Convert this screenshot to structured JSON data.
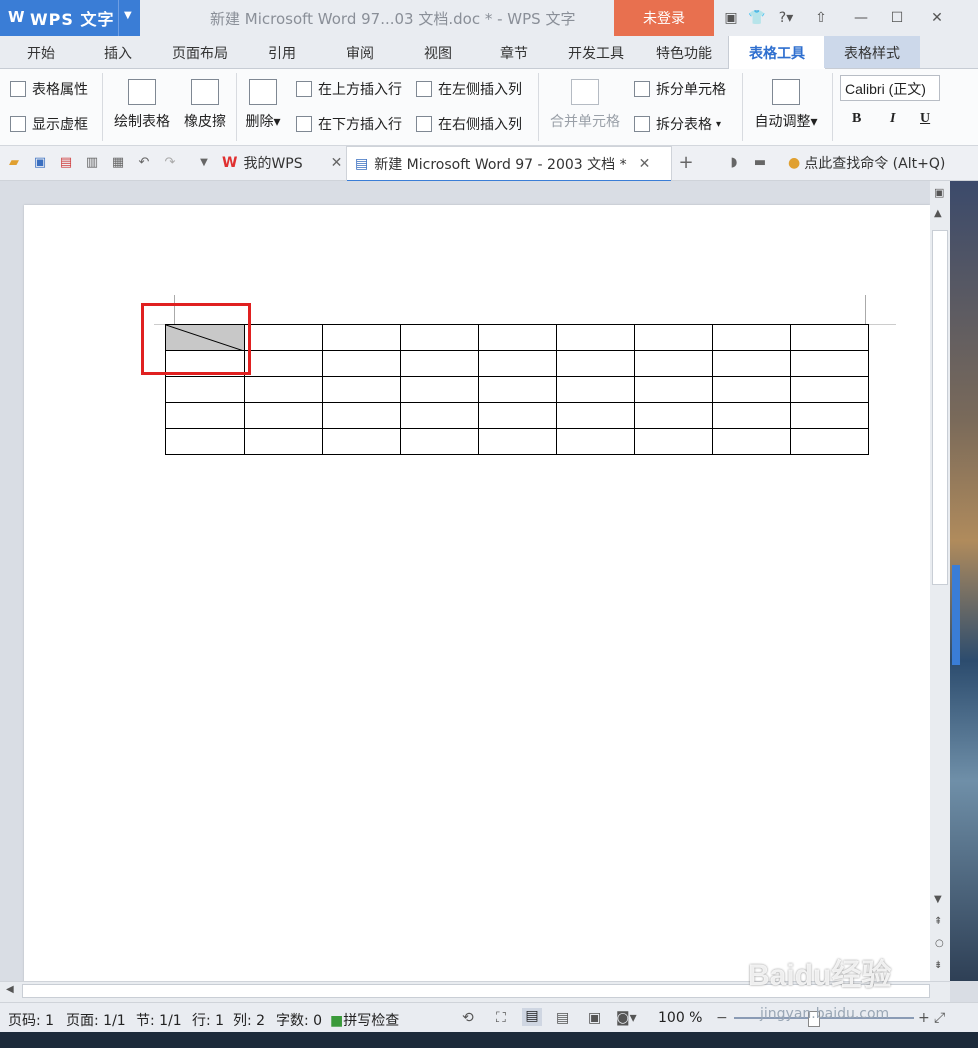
{
  "app": {
    "name": "WPS 文字",
    "logo": "W",
    "window_title": "新建 Microsoft Word 97...03 文档.doc * - WPS 文字",
    "login": "未登录"
  },
  "menu": [
    "开始",
    "插入",
    "页面布局",
    "引用",
    "审阅",
    "视图",
    "章节",
    "开发工具",
    "特色功能",
    "表格工具",
    "表格样式"
  ],
  "ribbon": {
    "table_props": "表格属性",
    "show_grid": "显示虚框",
    "draw_table": "绘制表格",
    "eraser": "橡皮擦",
    "delete": "删除",
    "insert_above": "在上方插入行",
    "insert_below": "在下方插入行",
    "insert_left": "在左侧插入列",
    "insert_right": "在右侧插入列",
    "merge_cells": "合并单元格",
    "split_cells": "拆分单元格",
    "split_table": "拆分表格",
    "auto_fit": "自动调整",
    "font": "Calibri (正文)",
    "bold": "B",
    "italic": "I",
    "underline": "U"
  },
  "tabs": {
    "mywps": "我的WPS",
    "doc": "新建 Microsoft Word 97 - 2003 文档 *",
    "find": "点此查找命令 (Alt+Q)"
  },
  "document": {
    "rows": 5,
    "cols": 9
  },
  "status": {
    "page_code": "页码: 1",
    "pages": "页面: 1/1",
    "section": "节: 1/1",
    "row": "行: 1",
    "col": "列: 2",
    "words": "字数: 0",
    "spell": "拼写检查",
    "zoom": "100 %"
  },
  "watermark": {
    "brand": "Baidu经验",
    "url": "jingyan.baidu.com"
  }
}
